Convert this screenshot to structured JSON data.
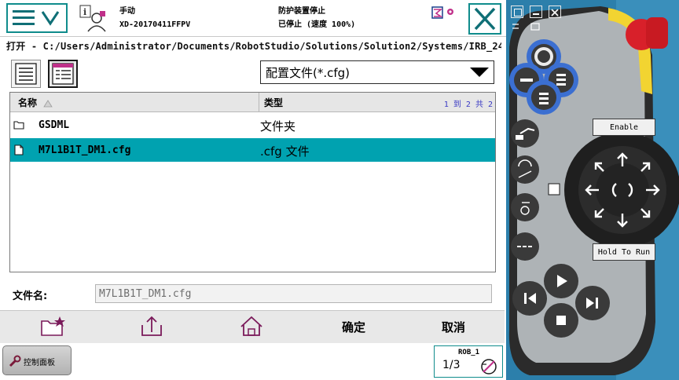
{
  "header": {
    "mode_label": "手动",
    "controller_id": "XD-20170411FFPV",
    "safety_status": "防护装置停止",
    "run_status": "已停止 (速度 100%)"
  },
  "path": {
    "text": "打开 - C:/Users/Administrator/Documents/RobotStudio/Solutions/Solution2/Systems/IRB_2400..."
  },
  "filter": {
    "selected": "配置文件(*.cfg)"
  },
  "list": {
    "col_name": "名称",
    "col_type": "类型",
    "pager": "1 到 2 共 2",
    "rows": [
      {
        "name": "GSDML",
        "type": "文件夹",
        "icon": "folder-icon"
      },
      {
        "name": "M7L1B1T_DM1.cfg",
        "type": ".cfg 文件",
        "icon": "file-icon"
      }
    ]
  },
  "filename": {
    "label": "文件名:",
    "value": "M7L1B1T_DM1.cfg"
  },
  "toolbar": {
    "ok_label": "确定",
    "cancel_label": "取消"
  },
  "taskbar": {
    "control_panel_label": "控制面板",
    "robot_label": "ROB_1",
    "speed_fraction": "1/3"
  },
  "pendant": {
    "enable_label": "Enable",
    "hold_to_run_label": "Hold To Run"
  }
}
